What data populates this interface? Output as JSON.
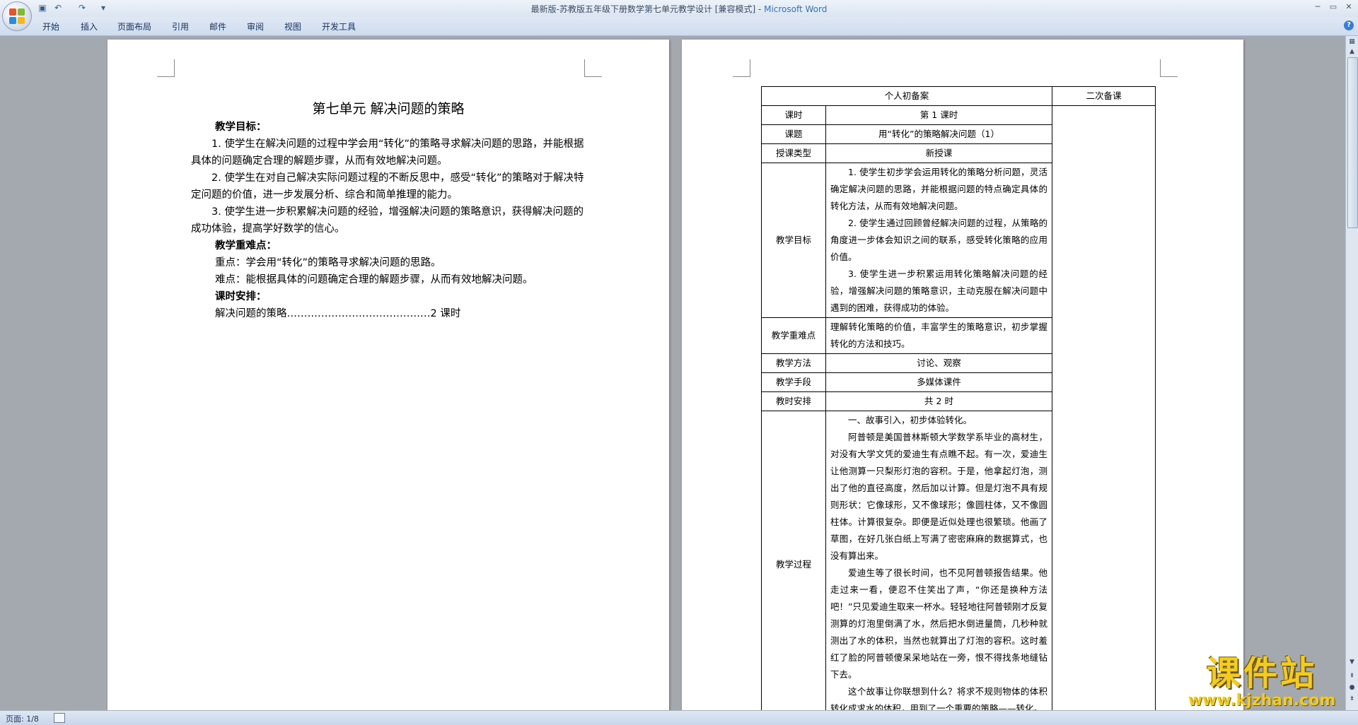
{
  "window": {
    "doc_title": "最新版-苏教版五年级下册数学第七单元教学设计 [兼容模式] - ",
    "app_name": "Microsoft Word"
  },
  "quick_access": {
    "icons": [
      "save-icon",
      "undo-icon",
      "redo-icon",
      "customize-icon"
    ]
  },
  "ribbon": {
    "tabs": [
      "开始",
      "插入",
      "页面布局",
      "引用",
      "邮件",
      "审阅",
      "视图",
      "开发工具"
    ]
  },
  "page1": {
    "title": "第七单元        解决问题的策略",
    "goals_heading": "教学目标：",
    "goal1": "1. 使学生在解决问题的过程中学会用“转化”的策略寻求解决问题的思路，并能根据具体的问题确定合理的解题步骤，从而有效地解决问题。",
    "goal2": "2. 使学生在对自己解决实际问题过程的不断反思中，感受“转化”的策略对于解决特定问题的价值，进一步发展分析、综合和简单推理的能力。",
    "goal3": "3. 使学生进一步积累解决问题的经验，增强解决问题的策略意识，获得解决问题的成功体验，提高学好数学的信心。",
    "key_heading": "教学重难点：",
    "key_point": "重点：学会用“转化”的策略寻求解决问题的思路。",
    "difficult_point": "难点：能根据具体的问题确定合理的解题步骤，从而有效地解决问题。",
    "schedule_heading": "课时安排：",
    "schedule_item": "解决问题的策略……………………………………2 课时"
  },
  "table": {
    "head_left": "个人初备案",
    "head_right": "二次备课",
    "rows": {
      "period_label": "课时",
      "period_value": "第 1 课时",
      "topic_label": "课题",
      "topic_value": "用“转化”的策略解决问题（1）",
      "type_label": "授课类型",
      "type_value": "新授课",
      "goals_label": "教学目标",
      "goals": [
        "1. 使学生初步学会运用转化的策略分析问题，灵活确定解决问题的思路，并能根据问题的特点确定具体的转化方法，从而有效地解决问题。",
        "2. 使学生通过回顾曾经解决问题的过程，从策略的角度进一步体会知识之间的联系，感受转化策略的应用价值。",
        "3. 使学生进一步积累运用转化策略解决问题的经验，增强解决问题的策略意识，主动克服在解决问题中遇到的困难，获得成功的体验。"
      ],
      "key_label": "教学重难点",
      "key_value": "理解转化策略的价值，丰富学生的策略意识，初步掌握转化的方法和技巧。",
      "method_label": "教学方法",
      "method_value": "讨论、观察",
      "means_label": "教学手段",
      "means_value": "多媒体课件",
      "hours_label": "教时安排",
      "hours_value": "共 2 时",
      "process_label": "教学过程",
      "process": [
        "一、故事引入，初步体验转化。",
        "阿普顿是美国普林斯顿大学数学系毕业的高材生，对没有大学文凭的爱迪生有点瞧不起。有一次，爱迪生让他测算一只梨形灯泡的容积。于是，他拿起灯泡，测出了他的直径高度，然后加以计算。但是灯泡不具有规则形状：它像球形，又不像球形；像圆柱体，又不像圆柱体。计算很复杂。即便是近似处理也很繁琐。他画了草图，在好几张白纸上写满了密密麻麻的数据算式，也没有算出来。",
        "爱迪生等了很长时间，也不见阿普顿报告结果。他走过来一看，便忍不住笑出了声，“你还是换种方法吧！”只见爱迪生取来一杯水。轻轻地往阿普顿刚才反复测算的灯泡里倒满了水，然后把水倒进量筒，几秒种就测出了水的体积，当然也就算出了灯泡的容积。这时羞红了脸的阿普顿傻呆呆地站在一旁，恨不得找条地缝钻下去。",
        "这个故事让你联想到什么？将求不规则物体的体积转化成求水的体积，用到了一个重要的策略——转化。"
      ]
    }
  },
  "status": {
    "page_info": "页面: 1/8"
  },
  "watermark": {
    "big": "课件站",
    "url": "www.kjzhan.com"
  }
}
